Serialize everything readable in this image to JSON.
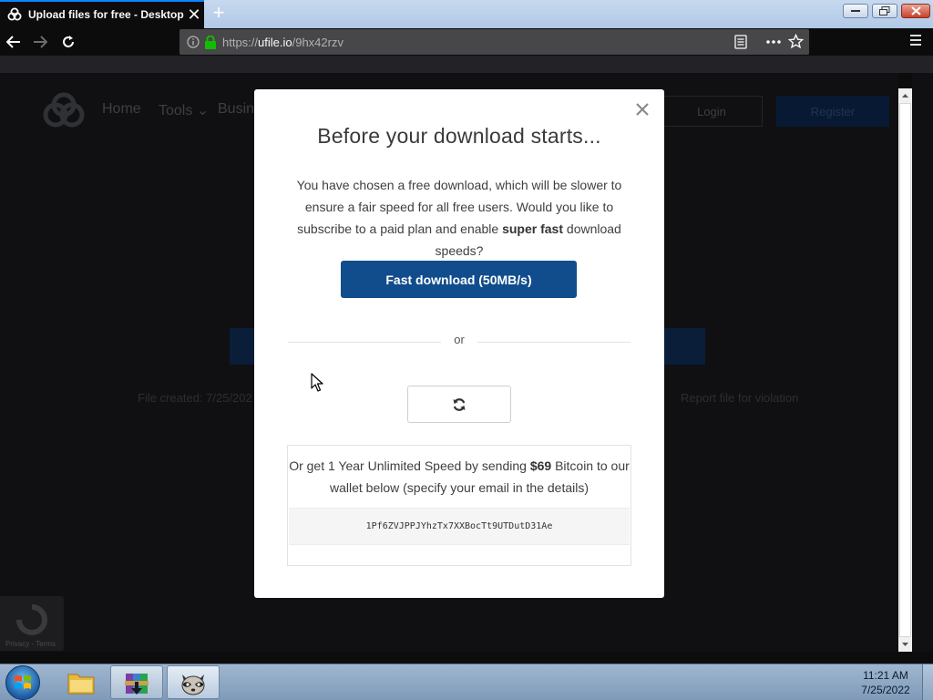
{
  "browser": {
    "tab_title": "Upload files for free - Desktop",
    "url_scheme": "https://",
    "url_host": "ufile.io",
    "url_path": "/9hx42rzv"
  },
  "site": {
    "nav": {
      "home": "Home",
      "tools": "Tools ⌄",
      "business": "Busin"
    },
    "login_label": "Login",
    "register_label": "Register",
    "file_created": "File created: 7/25/202",
    "report_label": "Report file for violation",
    "recaptcha_label": "Privacy - Terms"
  },
  "modal": {
    "title": "Before your download starts...",
    "body_part1": "You have chosen a free download, which will be slower to ensure a fair speed for all free users. Would you like to subscribe to a paid plan and enable ",
    "body_bold": "super fast",
    "body_part2": " download speeds?",
    "fast_download_label": "Fast download (50MB/s)",
    "or_label": "or",
    "bitcoin_part1": "Or get 1 Year Unlimited Speed by sending ",
    "bitcoin_amount": "$69",
    "bitcoin_part2": " Bitcoin to our wallet below (specify your email in the details)",
    "wallet_address": "1Pf6ZVJPPJYhzTx7XXBocTt9UTDutD31Ae"
  },
  "taskbar": {
    "clock_time": "11:21 AM",
    "clock_date": "7/25/2022"
  },
  "colors": {
    "accent_blue": "#114d8c",
    "browser_dark": "#0c0c0d",
    "lock_green": "#12bc00"
  }
}
